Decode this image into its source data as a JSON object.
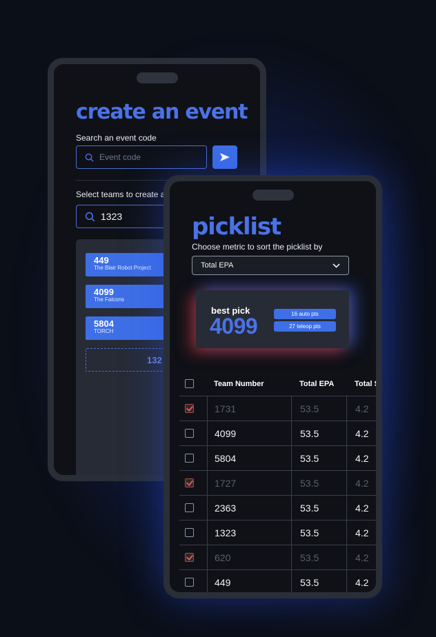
{
  "create_event": {
    "title": "create an event",
    "search_label": "Search an event code",
    "search_placeholder": "Event code",
    "teams_label": "Select teams to create a",
    "teams_query": "1323",
    "teams": [
      {
        "number": "449",
        "name": "The Blair Robot Project"
      },
      {
        "number": "4099",
        "name": "The Falcons"
      },
      {
        "number": "5804",
        "name": "TORCH"
      }
    ],
    "add_team_partial": "132"
  },
  "picklist": {
    "title": "picklist",
    "metric_label": "Choose metric to sort the picklist by",
    "metric_selected": "Total EPA",
    "best_pick": {
      "label": "best pick",
      "team": "4099",
      "auto": "16 auto pts",
      "teleop": "27 teleop pts"
    },
    "columns": [
      "Team Number",
      "Total EPA",
      "Total S"
    ],
    "rows": [
      {
        "team": "1731",
        "epa": "53.5",
        "s": "4.2",
        "picked": true
      },
      {
        "team": "4099",
        "epa": "53.5",
        "s": "4.2",
        "picked": false
      },
      {
        "team": "5804",
        "epa": "53.5",
        "s": "4.2",
        "picked": false
      },
      {
        "team": "1727",
        "epa": "53.5",
        "s": "4.2",
        "picked": true
      },
      {
        "team": "2363",
        "epa": "53.5",
        "s": "4.2",
        "picked": false
      },
      {
        "team": "1323",
        "epa": "53.5",
        "s": "4.2",
        "picked": false
      },
      {
        "team": "620",
        "epa": "53.5",
        "s": "4.2",
        "picked": true
      },
      {
        "team": "449",
        "epa": "53.5",
        "s": "4.2",
        "picked": false
      }
    ]
  },
  "colors": {
    "accent": "#3e6fe6",
    "title": "#4a72e8",
    "background": "#0b0f18",
    "picked": "#c86060"
  }
}
